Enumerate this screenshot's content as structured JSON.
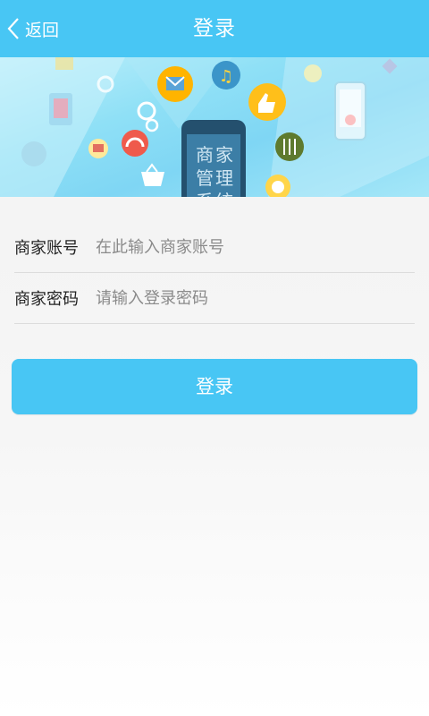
{
  "header": {
    "back_label": "返回",
    "title": "登录",
    "color": "#48c6f4"
  },
  "banner": {
    "phone_text": "商家管理系统"
  },
  "form": {
    "account": {
      "label": "商家账号",
      "placeholder": "在此输入商家账号",
      "value": ""
    },
    "password": {
      "label": "商家密码",
      "placeholder": "请输入登录密码",
      "value": ""
    }
  },
  "login_button": {
    "label": "登录"
  }
}
